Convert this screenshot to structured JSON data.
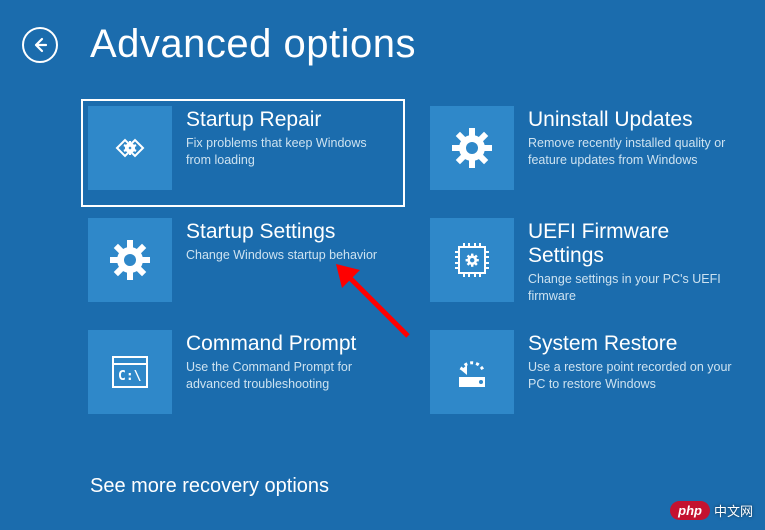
{
  "header": {
    "title": "Advanced options"
  },
  "tiles": [
    {
      "title": "Startup Repair",
      "desc": "Fix problems that keep Windows from loading",
      "icon": "repair-icon",
      "selected": true
    },
    {
      "title": "Uninstall Updates",
      "desc": "Remove recently installed quality or feature updates from Windows",
      "icon": "gear-icon",
      "selected": false
    },
    {
      "title": "Startup Settings",
      "desc": "Change Windows startup behavior",
      "icon": "gear-icon",
      "selected": false
    },
    {
      "title": "UEFI Firmware Settings",
      "desc": "Change settings in your PC's UEFI firmware",
      "icon": "chip-icon",
      "selected": false
    },
    {
      "title": "Command Prompt",
      "desc": "Use the Command Prompt for advanced troubleshooting",
      "icon": "cmd-icon",
      "selected": false
    },
    {
      "title": "System Restore",
      "desc": "Use a restore point recorded on your PC to restore Windows",
      "icon": "restore-icon",
      "selected": false
    }
  ],
  "see_more": "See more recovery options",
  "watermark": {
    "brand": "php",
    "text": "中文网"
  },
  "colors": {
    "bg": "#1b6cad",
    "tile": "#2f88c9",
    "outline": "#ffffff"
  }
}
